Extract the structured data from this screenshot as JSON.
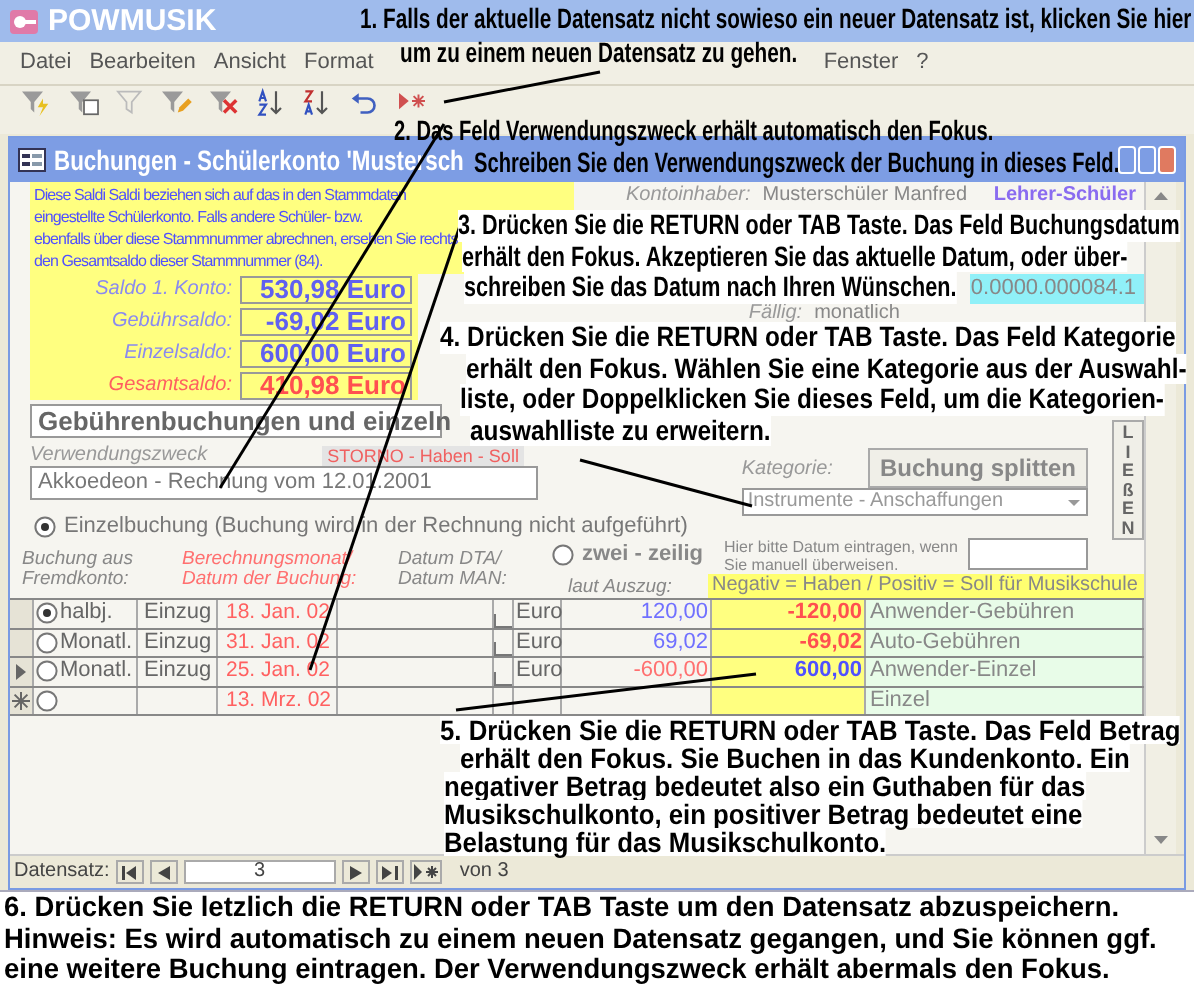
{
  "app_title": "POWMUSIK",
  "menu": [
    "Datei",
    "Bearbeiten",
    "Ansicht",
    "Format",
    "Fenster",
    "?"
  ],
  "form_title": "Buchungen - Schülerkonto 'Mustersch",
  "info_lines": [
    "Diese Saldi Saldi beziehen sich auf das in den Stammdaten",
    "eingestellte Schülerkonto. Falls andere Schüler- bzw.",
    "ebenfalls über diese Stammnummer abrechnen, ersehen Sie rechts",
    "den Gesamtsaldo dieser Stammnummer (84)."
  ],
  "account_holder": {
    "label": "Kontoinhaber:",
    "value": "Musterschüler Manfred",
    "badge": "Lehrer-Schüler"
  },
  "reference_value": "0.0000.000084.1",
  "due": {
    "label": "Fällig:",
    "value": "monatlich"
  },
  "balances": [
    {
      "label": "Saldo 1. Konto:",
      "value": "530,98 Euro",
      "kind": "normal"
    },
    {
      "label": "Gebührsaldo:",
      "value": "-69,02 Euro",
      "kind": "normal"
    },
    {
      "label": "Einzelsaldo:",
      "value": "600,00 Euro",
      "kind": "normal"
    },
    {
      "label": "Gesamtsaldo:",
      "value": "410,98 Euro",
      "kind": "total"
    }
  ],
  "section_header": "Gebührenbuchungen und einzeln",
  "purpose": {
    "label": "Verwendungszweck",
    "value": "Akkoedeon - Rechnung vom 12.01.2001"
  },
  "storno_label": "STORNO - Haben - Soll",
  "category": {
    "label": "Kategorie:",
    "value": "Instrumente - Anschaffungen"
  },
  "split_button": "Buchung splitten",
  "side_button": "LIEßEN",
  "booking_modes": [
    {
      "label": "Einzelbuchung (Buchung wird in der Rechnung nicht aufgeführt)",
      "selected": true
    },
    {
      "label": "zwei - zeilig",
      "selected": false
    }
  ],
  "manual_date_hint": "Hier bitte Datum eintragen, wenn Sie manuell überweisen.",
  "table": {
    "column_headers": [
      "Buchung aus Fremdkonto:",
      "Berechnungsmonat/ Datum der Buchung:",
      "Datum DTA/ Datum MAN:",
      "laut Auszug:",
      "Negativ = Haben / Positiv = Soll für Musikschule"
    ],
    "rows": [
      {
        "current": false,
        "new": false,
        "selected": true,
        "interval": "halbj.",
        "type": "Einzug",
        "date": "18. Jan. 02",
        "checked": false,
        "currency": "Euro",
        "statement": "120,00",
        "amount": "-120,00",
        "kind": "debit",
        "category": "Anwender-Gebühren"
      },
      {
        "current": false,
        "new": false,
        "selected": false,
        "interval": "Monatl.",
        "type": "Einzug",
        "date": "31. Jan. 02",
        "checked": false,
        "currency": "Euro",
        "statement": "69,02",
        "amount": "-69,02",
        "kind": "debit",
        "category": "Auto-Gebühren"
      },
      {
        "current": true,
        "new": false,
        "selected": false,
        "interval": "Monatl.",
        "type": "Einzug",
        "date": "25. Jan. 02",
        "checked": false,
        "currency": "Euro",
        "statement": "-600,00",
        "amount": "600,00",
        "kind": "credit",
        "category": "Anwender-Einzel"
      },
      {
        "current": false,
        "new": true,
        "selected": false,
        "date": "13. Mrz. 02",
        "category": "Einzel"
      }
    ]
  },
  "nav": {
    "label": "Datensatz:",
    "current": "3",
    "total": "von 3"
  },
  "callouts": [
    {
      "lines": [
        "1. Falls der aktuelle Datensatz nicht sowieso ein neuer Datensatz ist, klicken Sie hier",
        "um zu einem neuen Datensatz zu gehen."
      ]
    },
    {
      "lines": [
        "2. Das Feld Verwendungszweck erhält automatisch den Fokus.",
        "Schreiben Sie den Verwendungszweck der Buchung in dieses Feld."
      ]
    },
    {
      "lines": [
        "3. Drücken Sie die RETURN oder TAB Taste. Das Feld Buchungsdatum",
        "erhält den Fokus. Akzeptieren Sie das aktuelle Datum, oder über-",
        "schreiben Sie das Datum nach Ihren Wünschen."
      ]
    },
    {
      "lines": [
        "4. Drücken Sie die RETURN oder TAB Taste. Das Feld Kategorie",
        "erhält den Fokus. Wählen Sie eine Kategorie aus der Auswahl-",
        "liste, oder Doppelklicken Sie dieses Feld, um die Kategorien-",
        "auswahlliste zu erweitern."
      ]
    },
    {
      "lines": [
        "5. Drücken Sie die RETURN oder TAB Taste. Das Feld Betrag",
        "erhält den Fokus. Sie Buchen in das Kundenkonto. Ein",
        "negativer Betrag bedeutet also ein Guthaben für das",
        "Musikschulkonto, ein positiver Betrag bedeutet eine",
        "Belastung für das Musikschulkonto."
      ]
    },
    {
      "lines": [
        "6. Drücken Sie letzlich die RETURN oder TAB Taste um den Datensatz abzuspeichern.",
        "Hinweis: Es wird automatisch zu einem neuen Datensatz gegangen, und Sie können ggf.",
        "eine weitere Buchung eintragen. Der Verwendungszweck erhält abermals den Fokus."
      ]
    }
  ]
}
